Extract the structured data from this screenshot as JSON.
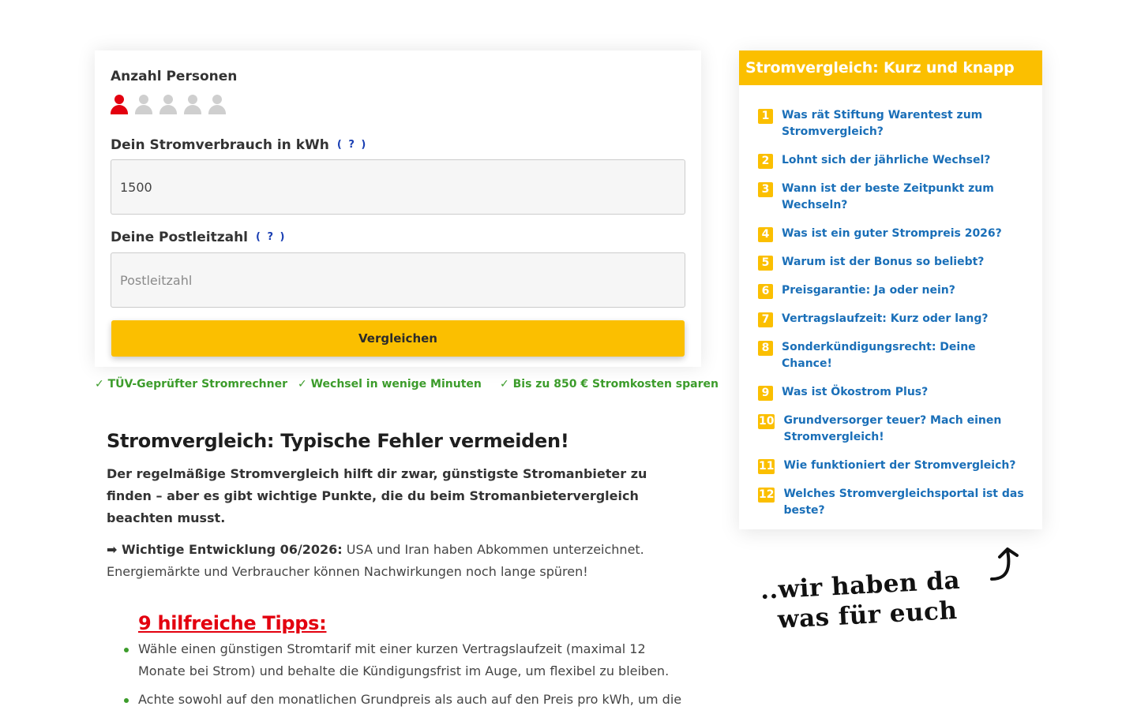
{
  "calculator": {
    "persons_label": "Anzahl Personen",
    "persons": [
      {
        "selected": true
      },
      {
        "selected": false
      },
      {
        "selected": false
      },
      {
        "selected": false
      },
      {
        "selected": false
      }
    ],
    "consumption_label": "Dein Stromverbrauch in kWh",
    "consumption_help": "( ? )",
    "consumption_value": "1500",
    "postcode_label": "Deine Postleitzahl",
    "postcode_help": "( ? )",
    "postcode_value": "",
    "postcode_placeholder": "Postleitzahl",
    "compare_button": "Vergleichen"
  },
  "badges": [
    "✓ TÜV-Geprüfter Stromrechner",
    "✓ Wechsel in wenige Minuten",
    "✓ Bis zu 850 € Stromkosten sparen"
  ],
  "article": {
    "title": "Stromvergleich: Typische Fehler vermeiden!",
    "intro": "Der regelmäßige Stromvergleich hilft dir zwar, günstigste Stromanbieter zu finden – aber es gibt wichtige Punkte, die du beim Stromanbietervergleich beachten musst.",
    "news_label": "➡ Wichtige Entwicklung 06/2026:",
    "news_text": " USA und Iran haben Abkommen unterzeichnet. Energiemärkte und Verbraucher können Nachwirkungen noch lange spüren!",
    "tips_heading": "9 hilfreiche Tipps:",
    "tips": [
      "Wähle einen günstigen Stromtarif mit einer kurzen Vertragslaufzeit (maximal 12 Monate bei Strom) und behalte die Kündigungsfrist im Auge, um flexibel zu bleiben.",
      "Achte sowohl auf den monatlichen Grundpreis als auch auf den Preis pro kWh, um die Gesamtkosten realistisch einschätzen zu können."
    ]
  },
  "toc": {
    "title": "Stromvergleich: Kurz und knapp",
    "items": [
      {
        "num": "1",
        "label": "Was rät Stiftung Warentest zum Stromvergleich?"
      },
      {
        "num": "2",
        "label": "Lohnt sich der jährliche Wechsel?"
      },
      {
        "num": "3",
        "label": "Wann ist der beste Zeitpunkt zum Wechseln?"
      },
      {
        "num": "4",
        "label": "Was ist ein guter Strompreis 2026?"
      },
      {
        "num": "5",
        "label": "Warum ist der Bonus so beliebt?"
      },
      {
        "num": "6",
        "label": "Preisgarantie: Ja oder nein?"
      },
      {
        "num": "7",
        "label": "Vertragslaufzeit: Kurz oder lang?"
      },
      {
        "num": "8",
        "label": "Sonderkündigungsrecht: Deine Chance!"
      },
      {
        "num": "9",
        "label": "Was ist Ökostrom Plus?"
      },
      {
        "num": "10",
        "label": "Grundversorger teuer? Mach einen Stromvergleich!"
      },
      {
        "num": "11",
        "label": "Wie funktioniert der Stromvergleich?"
      },
      {
        "num": "12",
        "label": "Welches Stromvergleichsportal ist das beste?"
      }
    ]
  },
  "note": {
    "line1": "..wir haben da",
    "line2": "was für euch"
  },
  "colors": {
    "accent": "#fbbf00",
    "link": "#1a6fb8",
    "badge_green": "#3c9c2b",
    "tips_red": "#e3000f",
    "person_active": "#e3000f",
    "person_inactive": "#cfcfcf"
  },
  "icons": [
    "person-icon",
    "check-icon",
    "arrow-right-icon",
    "curved-arrow-icon"
  ]
}
